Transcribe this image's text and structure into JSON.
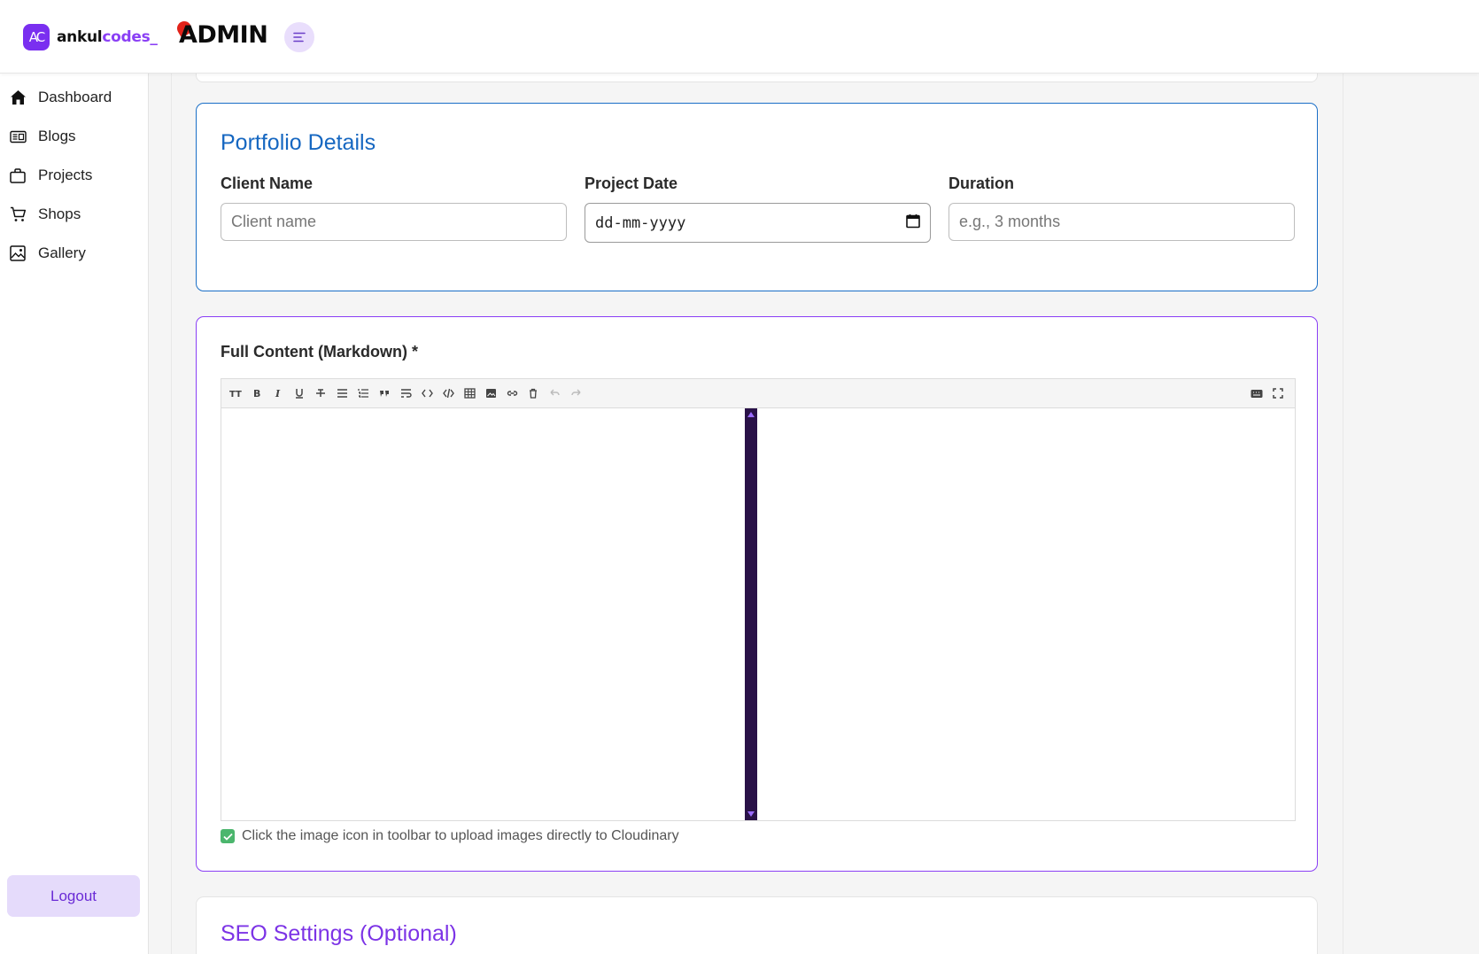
{
  "header": {
    "logo_mark": "AC",
    "brand_prefix": "ankul",
    "brand_accent": "codes_",
    "admin_label": "ADMIN"
  },
  "sidebar": {
    "items": [
      {
        "label": "Dashboard",
        "icon": "home-icon"
      },
      {
        "label": "Blogs",
        "icon": "newspaper-icon"
      },
      {
        "label": "Projects",
        "icon": "briefcase-icon"
      },
      {
        "label": "Shops",
        "icon": "cart-icon"
      },
      {
        "label": "Gallery",
        "icon": "image-icon"
      }
    ],
    "logout_label": "Logout"
  },
  "portfolio": {
    "title": "Portfolio Details",
    "client_name_label": "Client Name",
    "client_name_placeholder": "Client name",
    "project_date_label": "Project Date",
    "project_date_value": "dd-mm-yyyy",
    "duration_label": "Duration",
    "duration_placeholder": "e.g., 3 months"
  },
  "content_editor": {
    "label": "Full Content (Markdown) *",
    "toolbar_icons": [
      "heading-icon",
      "bold-icon",
      "italic-icon",
      "underline-icon",
      "strikethrough-icon",
      "bullet-list-icon",
      "numbered-list-icon",
      "quote-icon",
      "wrap-icon",
      "inline-code-icon",
      "code-block-icon",
      "table-icon",
      "image-icon",
      "link-icon",
      "delete-icon",
      "undo-icon",
      "redo-icon"
    ],
    "right_toolbar_icons": [
      "keyboard-icon",
      "fullscreen-icon"
    ],
    "hint": "Click the image icon in toolbar to upload images directly to Cloudinary"
  },
  "seo": {
    "title": "SEO Settings (Optional)"
  },
  "colors": {
    "brand_purple": "#7a2ff0",
    "portfolio_border": "#1a6fc7",
    "content_border": "#8a3ff5",
    "divider": "#2a1248",
    "check_green": "#4bb66d"
  }
}
